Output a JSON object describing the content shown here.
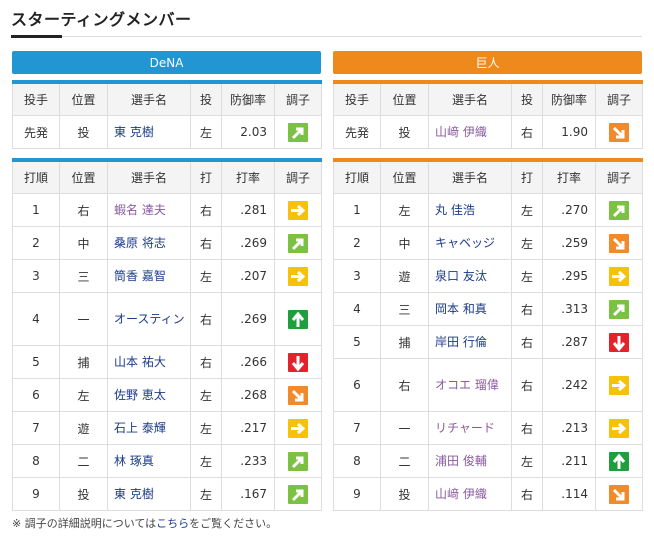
{
  "section_title": "スターティングメンバー",
  "teams": {
    "dena": {
      "name": "DeNA"
    },
    "kyojin": {
      "name": "巨人"
    }
  },
  "pitch_headers": [
    "投手",
    "位置",
    "選手名",
    "投",
    "防御率",
    "調子"
  ],
  "order_headers": [
    "打順",
    "位置",
    "選手名",
    "打",
    "打率",
    "調子"
  ],
  "dena_pitcher": {
    "role": "先発",
    "pos": "投",
    "name": "東 克樹",
    "hand": "左",
    "era": "2.03",
    "cond": "up-right"
  },
  "kyojin_pitcher": {
    "role": "先発",
    "pos": "投",
    "name": "山﨑 伊織",
    "hand": "右",
    "era": "1.90",
    "cond": "down-right"
  },
  "dena_order": [
    {
      "no": "1",
      "pos": "右",
      "name": "蝦名 達夫",
      "hand": "右",
      "avg": ".281",
      "cond": "right"
    },
    {
      "no": "2",
      "pos": "中",
      "name": "桑原 将志",
      "hand": "右",
      "avg": ".269",
      "cond": "up-right"
    },
    {
      "no": "3",
      "pos": "三",
      "name": "筒香 嘉智",
      "hand": "左",
      "avg": ".207",
      "cond": "right"
    },
    {
      "no": "4",
      "pos": "一",
      "name": "オースティン",
      "hand": "右",
      "avg": ".269",
      "cond": "up"
    },
    {
      "no": "5",
      "pos": "捕",
      "name": "山本 祐大",
      "hand": "右",
      "avg": ".266",
      "cond": "down"
    },
    {
      "no": "6",
      "pos": "左",
      "name": "佐野 恵太",
      "hand": "左",
      "avg": ".268",
      "cond": "down-right"
    },
    {
      "no": "7",
      "pos": "遊",
      "name": "石上 泰輝",
      "hand": "左",
      "avg": ".217",
      "cond": "right"
    },
    {
      "no": "8",
      "pos": "二",
      "name": "林 琢真",
      "hand": "左",
      "avg": ".233",
      "cond": "up-right"
    },
    {
      "no": "9",
      "pos": "投",
      "name": "東 克樹",
      "hand": "左",
      "avg": ".167",
      "cond": "up-right"
    }
  ],
  "kyojin_order": [
    {
      "no": "1",
      "pos": "左",
      "name": "丸 佳浩",
      "hand": "左",
      "avg": ".270",
      "cond": "up-right"
    },
    {
      "no": "2",
      "pos": "中",
      "name": "キャベッジ",
      "hand": "左",
      "avg": ".259",
      "cond": "down-right"
    },
    {
      "no": "3",
      "pos": "遊",
      "name": "泉口 友汰",
      "hand": "左",
      "avg": ".295",
      "cond": "right"
    },
    {
      "no": "4",
      "pos": "三",
      "name": "岡本 和真",
      "hand": "右",
      "avg": ".313",
      "cond": "up-right"
    },
    {
      "no": "5",
      "pos": "捕",
      "name": "岸田 行倫",
      "hand": "右",
      "avg": ".287",
      "cond": "down"
    },
    {
      "no": "6",
      "pos": "右",
      "name": "オコエ 瑠偉",
      "hand": "右",
      "avg": ".242",
      "cond": "right"
    },
    {
      "no": "7",
      "pos": "一",
      "name": "リチャード",
      "hand": "右",
      "avg": ".213",
      "cond": "right"
    },
    {
      "no": "8",
      "pos": "二",
      "name": "浦田 俊輔",
      "hand": "左",
      "avg": ".211",
      "cond": "up"
    },
    {
      "no": "9",
      "pos": "投",
      "name": "山﨑 伊織",
      "hand": "右",
      "avg": ".114",
      "cond": "down-right"
    }
  ],
  "footnote": {
    "prefix": "※ 調子の詳細説明については",
    "link": "こちら",
    "suffix": "をご覧ください。"
  }
}
